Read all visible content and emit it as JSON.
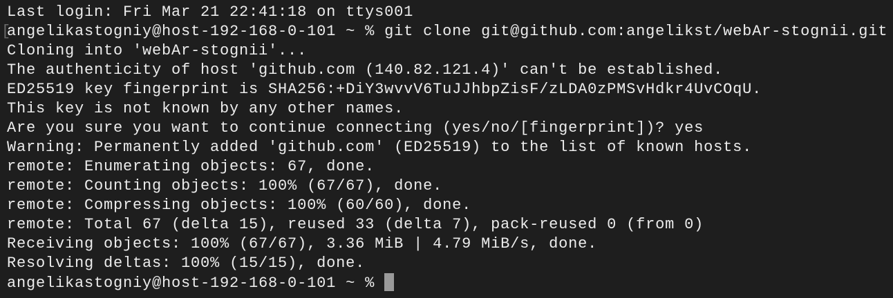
{
  "terminal": {
    "lines": [
      "Last login: Fri Mar 21 22:41:18 on ttys001",
      "angelikastogniy@host-192-168-0-101 ~ % git clone git@github.com:angelikst/webAr-stognii.git",
      "Cloning into 'webAr-stognii'...",
      "The authenticity of host 'github.com (140.82.121.4)' can't be established.",
      "ED25519 key fingerprint is SHA256:+DiY3wvvV6TuJJhbpZisF/zLDA0zPMSvHdkr4UvCOqU.",
      "This key is not known by any other names.",
      "Are you sure you want to continue connecting (yes/no/[fingerprint])? yes",
      "Warning: Permanently added 'github.com' (ED25519) to the list of known hosts.",
      "remote: Enumerating objects: 67, done.",
      "remote: Counting objects: 100% (67/67), done.",
      "remote: Compressing objects: 100% (60/60), done.",
      "remote: Total 67 (delta 15), reused 33 (delta 7), pack-reused 0 (from 0)",
      "Receiving objects: 100% (67/67), 3.36 MiB | 4.79 MiB/s, done.",
      "Resolving deltas: 100% (15/15), done."
    ],
    "mark": "[",
    "prompt": "angelikastogniy@host-192-168-0-101 ~ %"
  }
}
